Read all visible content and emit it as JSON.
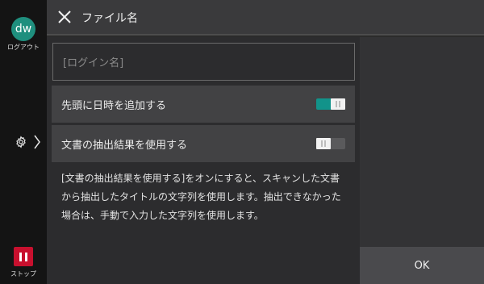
{
  "sidebar": {
    "avatar_initials": "dw",
    "logout_label": "ログアウト",
    "settings_icon": "gear-icon",
    "stop_label": "ストップ"
  },
  "header": {
    "title": "ファイル名",
    "close_icon": "close-icon"
  },
  "form": {
    "name_placeholder": "[ログイン名]",
    "rows": [
      {
        "label": "先頭に日時を追加する",
        "toggle": "on"
      },
      {
        "label": "文書の抽出結果を使用する",
        "toggle": "off"
      }
    ],
    "description": "[文書の抽出結果を使用する]をオンにすると、スキャンした文書から抽出したタイトルの文字列を使用します。抽出できなかった場合は、手動で入力した文字列を使用します。"
  },
  "footer": {
    "ok_label": "OK"
  },
  "colors": {
    "accent": "#12938a",
    "avatar": "#1f8f7e",
    "stop": "#c8102e"
  }
}
